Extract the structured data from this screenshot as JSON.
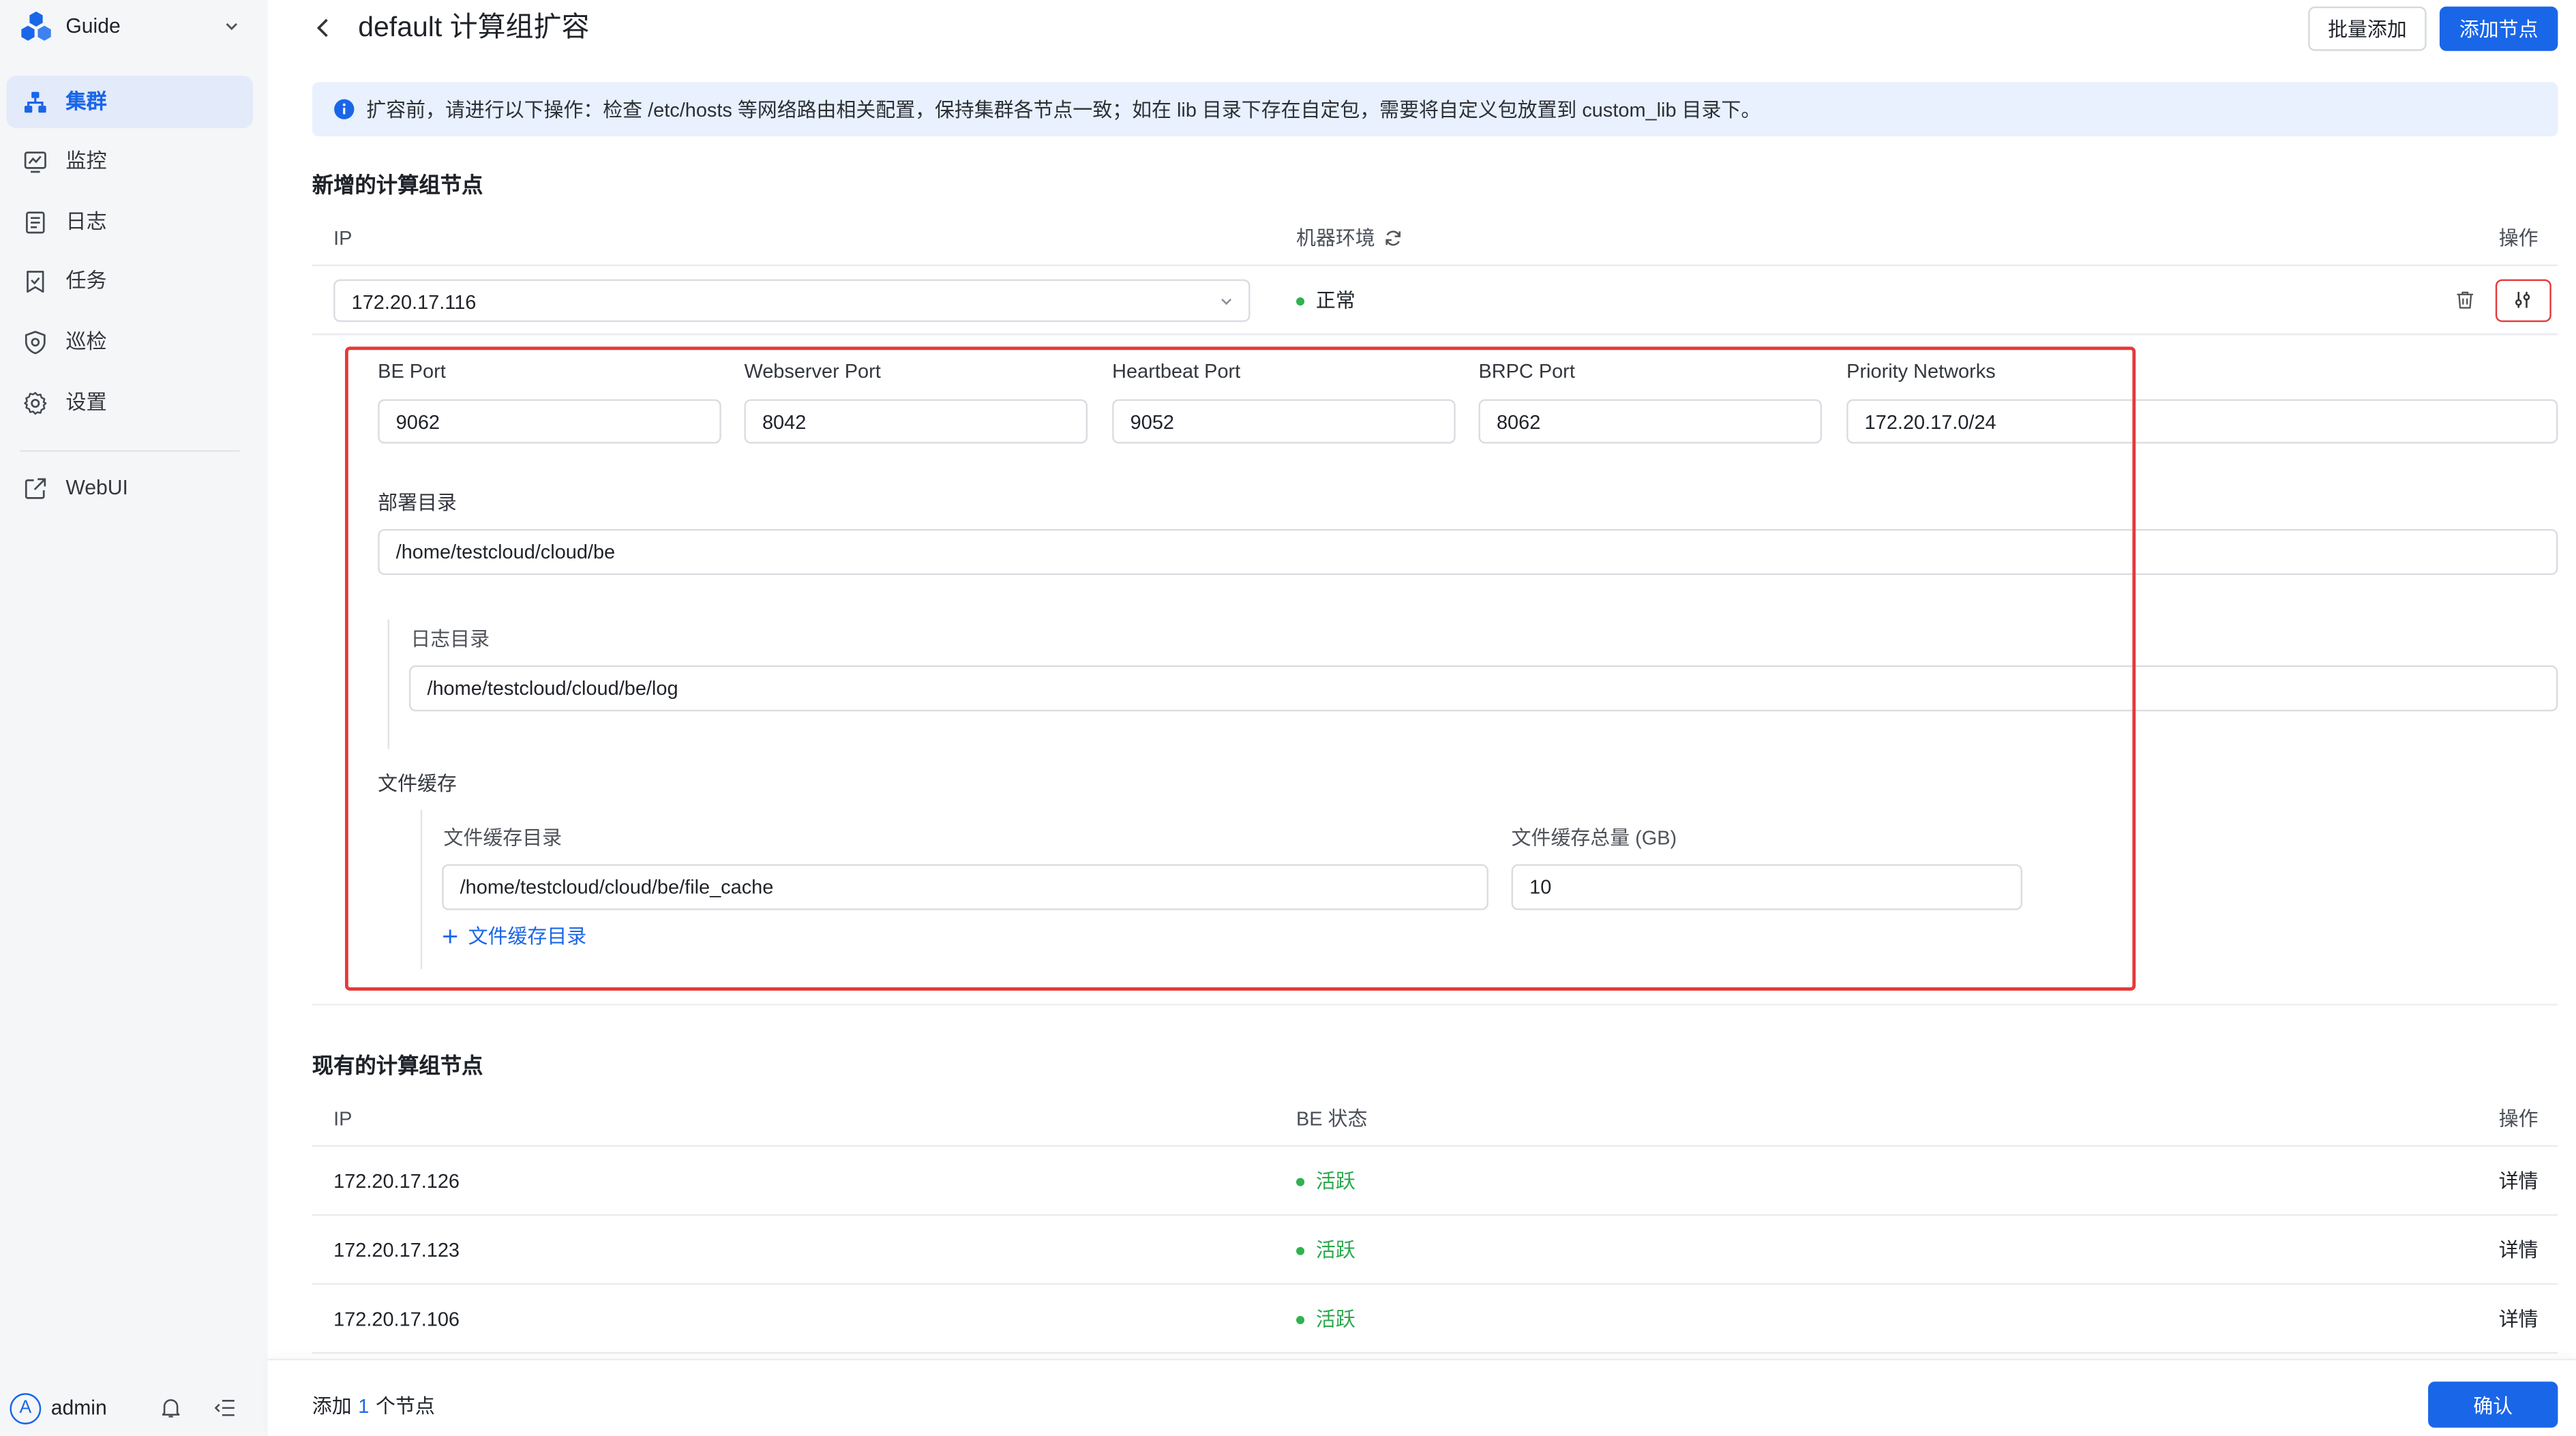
{
  "sidebar": {
    "brand": "Guide",
    "brand_icon": "logo-icon",
    "items": [
      {
        "label": "集群",
        "icon": "cluster-icon",
        "active": true
      },
      {
        "label": "监控",
        "icon": "monitor-icon",
        "active": false
      },
      {
        "label": "日志",
        "icon": "log-icon",
        "active": false
      },
      {
        "label": "任务",
        "icon": "task-icon",
        "active": false
      },
      {
        "label": "巡检",
        "icon": "inspection-icon",
        "active": false
      },
      {
        "label": "设置",
        "icon": "settings-icon",
        "active": false
      }
    ],
    "webui": {
      "label": "WebUI",
      "icon": "external-link-icon"
    },
    "user": {
      "avatar_letter": "A",
      "name": "admin",
      "icons": [
        "bell-icon",
        "collapse-menu-icon"
      ]
    }
  },
  "header": {
    "back_icon": "chevron-left-icon",
    "title": "default 计算组扩容",
    "batch_add_label": "批量添加",
    "add_node_label": "添加节点"
  },
  "notice": {
    "icon": "info-icon",
    "text": "扩容前，请进行以下操作：检查 /etc/hosts 等网络路由相关配置，保持集群各节点一致；如在 lib 目录下存在自定包，需要将自定义包放置到 custom_lib 目录下。"
  },
  "new_nodes": {
    "title": "新增的计算组节点",
    "columns": {
      "ip": "IP",
      "environment": "机器环境",
      "actions": "操作"
    },
    "rows": [
      {
        "ip": "172.20.17.116",
        "environment_status": "正常",
        "actions": [
          "trash-icon",
          "sliders-icon"
        ]
      }
    ],
    "config": {
      "be_port": {
        "label": "BE Port",
        "value": "9062"
      },
      "webserver_port": {
        "label": "Webserver Port",
        "value": "8042"
      },
      "heartbeat_port": {
        "label": "Heartbeat Port",
        "value": "9052"
      },
      "brpc_port": {
        "label": "BRPC Port",
        "value": "8062"
      },
      "priority_networks": {
        "label": "Priority Networks",
        "value": "172.20.17.0/24"
      },
      "deploy_dir": {
        "label": "部署目录",
        "value": "/home/testcloud/cloud/be"
      },
      "log_dir": {
        "label": "日志目录",
        "value": "/home/testcloud/cloud/be/log"
      },
      "file_cache": {
        "title": "文件缓存",
        "dir": {
          "label": "文件缓存目录",
          "value": "/home/testcloud/cloud/be/file_cache"
        },
        "size": {
          "label": "文件缓存总量 (GB)",
          "value": "10"
        },
        "add_dir_label": "文件缓存目录"
      }
    }
  },
  "existing_nodes": {
    "title": "现有的计算组节点",
    "columns": {
      "ip": "IP",
      "status": "BE 状态",
      "actions": "操作"
    },
    "rows": [
      {
        "ip": "172.20.17.126",
        "status": "活跃",
        "action": "详情"
      },
      {
        "ip": "172.20.17.123",
        "status": "活跃",
        "action": "详情"
      },
      {
        "ip": "172.20.17.106",
        "status": "活跃",
        "action": "详情"
      }
    ]
  },
  "footer": {
    "prefix": "添加",
    "count": "1",
    "suffix": "个节点",
    "confirm_label": "确认"
  },
  "colors": {
    "primary": "#1a66e8",
    "success": "#2fb34f",
    "highlight": "#e5393a",
    "sidebar_bg": "#f5f6f8",
    "notice_bg": "#e8f1fd"
  }
}
